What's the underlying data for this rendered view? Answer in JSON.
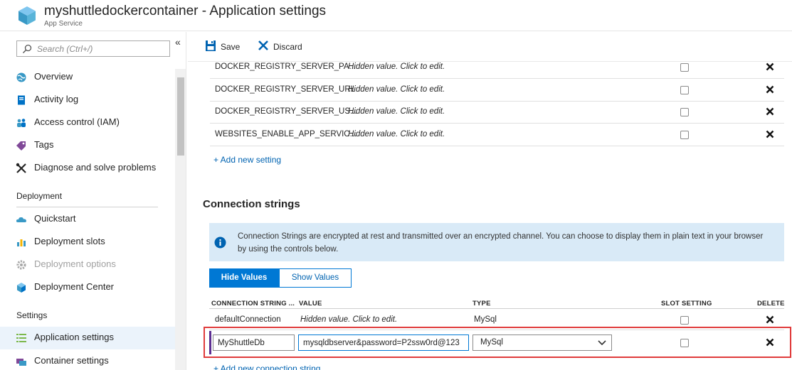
{
  "header": {
    "title": "myshuttledockercontainer - Application settings",
    "subtitle": "App Service",
    "logo_icon": "app-service-cube-icon"
  },
  "sidebar": {
    "collapse_glyph": "«",
    "search_placeholder": "Search (Ctrl+/)",
    "items": [
      {
        "label": "Overview",
        "icon": "globe-icon"
      },
      {
        "label": "Activity log",
        "icon": "book-icon"
      },
      {
        "label": "Access control (IAM)",
        "icon": "people-icon"
      },
      {
        "label": "Tags",
        "icon": "tag-icon"
      },
      {
        "label": "Diagnose and solve problems",
        "icon": "wrench-icon"
      }
    ],
    "sections": [
      {
        "title": "Deployment",
        "items": [
          {
            "label": "Quickstart",
            "icon": "cloud-icon"
          },
          {
            "label": "Deployment slots",
            "icon": "slots-icon"
          },
          {
            "label": "Deployment options",
            "icon": "gear-icon",
            "disabled": true
          },
          {
            "label": "Deployment Center",
            "icon": "cube-icon"
          }
        ]
      },
      {
        "title": "Settings",
        "items": [
          {
            "label": "Application settings",
            "icon": "list-icon",
            "active": true
          },
          {
            "label": "Container settings",
            "icon": "container-icon"
          }
        ]
      }
    ]
  },
  "toolbar": {
    "save_label": "Save",
    "discard_label": "Discard"
  },
  "app_settings": {
    "rows": [
      {
        "name": "DOCKER_REGISTRY_SERVER_PA...",
        "value": "Hidden value. Click to edit."
      },
      {
        "name": "DOCKER_REGISTRY_SERVER_URL",
        "value": "Hidden value. Click to edit."
      },
      {
        "name": "DOCKER_REGISTRY_SERVER_US...",
        "value": "Hidden value. Click to edit."
      },
      {
        "name": "WEBSITES_ENABLE_APP_SERVIC...",
        "value": "Hidden value. Click to edit."
      }
    ],
    "add_label": "+ Add new setting"
  },
  "connection_strings": {
    "heading": "Connection strings",
    "info_text": "Connection Strings are encrypted at rest and transmitted over an encrypted channel. You can choose to display them in plain text in your browser by using the controls below.",
    "hide_values_label": "Hide Values",
    "show_values_label": "Show Values",
    "columns": {
      "name": "CONNECTION STRING ...",
      "value": "VALUE",
      "type": "TYPE",
      "slot": "SLOT SETTING",
      "delete": "DELETE"
    },
    "rows": [
      {
        "name": "defaultConnection",
        "value": "Hidden value. Click to edit.",
        "type": "MySql"
      }
    ],
    "editing_row": {
      "name": "MyShuttleDb",
      "value": "mysqldbserver&password=P2ssw0rd@123",
      "type": "MySql"
    },
    "add_label": "+ Add new connection string"
  },
  "colors": {
    "accent": "#0078d4",
    "highlight_border": "#e03b3b",
    "info_background": "#d9eaf7",
    "row_accent": "#5c2d91"
  }
}
